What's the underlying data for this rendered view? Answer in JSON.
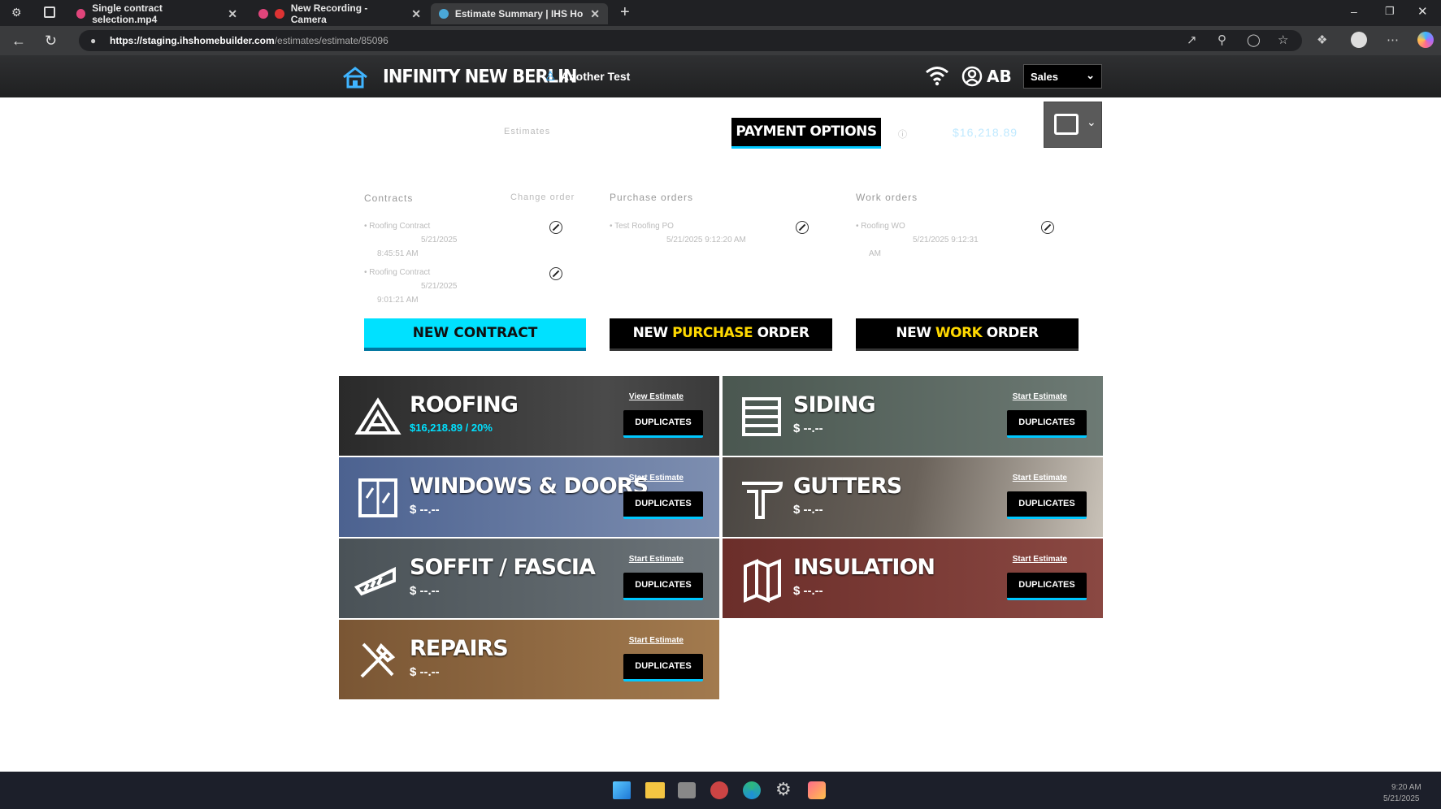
{
  "browser": {
    "tabs": [
      {
        "label": "Single contract selection.mp4",
        "active": false
      },
      {
        "label": "New Recording - Camera",
        "active": false
      },
      {
        "label": "Estimate Summary | IHS Home B...",
        "active": true
      }
    ],
    "url_host": "https://staging.ihshomebuilder.com",
    "url_path": "/estimates/estimate/85096"
  },
  "app": {
    "brand": "INFINITY NEW BERLIN",
    "user_name": "Another Test",
    "user_initials": "AB",
    "role_select": "Sales"
  },
  "summary": {
    "breadcrumb": "Estimates",
    "payment_button": "PAYMENT OPTIONS",
    "total": "$16,218.89"
  },
  "sections": {
    "contracts": {
      "title": "Contracts",
      "action": "Change order",
      "items": [
        {
          "name": "Roofing Contract",
          "date": "5/21/2025",
          "time": "8:45:51 AM"
        },
        {
          "name": "Roofing Contract",
          "date": "5/21/2025",
          "time": "9:01:21 AM"
        }
      ],
      "new_button": "NEW CONTRACT"
    },
    "purchase_orders": {
      "title": "Purchase orders",
      "items": [
        {
          "name": "Test Roofing PO",
          "date": "5/21/2025 9:12:20 AM"
        }
      ],
      "new_prefix": "NEW ",
      "new_highlight": "PURCHASE",
      "new_suffix": " ORDER"
    },
    "work_orders": {
      "title": "Work orders",
      "items": [
        {
          "name": "Roofing WO",
          "date": "5/21/2025 9:12:31",
          "time": "AM"
        }
      ],
      "new_prefix": "NEW ",
      "new_highlight": "WORK",
      "new_suffix": " ORDER"
    }
  },
  "categories": [
    {
      "title": "ROOFING",
      "price": "$16,218.89 / 20%",
      "link": "View Estimate",
      "dup": "DUPLICATES",
      "bg": "#3c3c3c",
      "accent": "#00e1ff"
    },
    {
      "title": "SIDING",
      "price": "$ --.--",
      "link": "Start Estimate",
      "dup": "DUPLICATES",
      "bg": "#5c6b66"
    },
    {
      "title": "WINDOWS & DOORS",
      "price": "$ --.--",
      "link": "Start Estimate",
      "dup": "DUPLICATES",
      "bg": "#5a6f9a"
    },
    {
      "title": "GUTTERS",
      "price": "$ --.--",
      "link": "Start Estimate",
      "dup": "DUPLICATES",
      "bg": "#5a5550"
    },
    {
      "title": "SOFFIT / FASCIA",
      "price": "$ --.--",
      "link": "Start Estimate",
      "dup": "DUPLICATES",
      "bg": "#555d63"
    },
    {
      "title": "INSULATION",
      "price": "$ --.--",
      "link": "Start Estimate",
      "dup": "DUPLICATES",
      "bg": "#7a3a36"
    },
    {
      "title": "REPAIRS",
      "price": "$ --.--",
      "link": "Start Estimate",
      "dup": "DUPLICATES",
      "bg": "#8a6740"
    }
  ],
  "taskbar": {
    "time": "9:20 AM",
    "date": "5/21/2025"
  }
}
